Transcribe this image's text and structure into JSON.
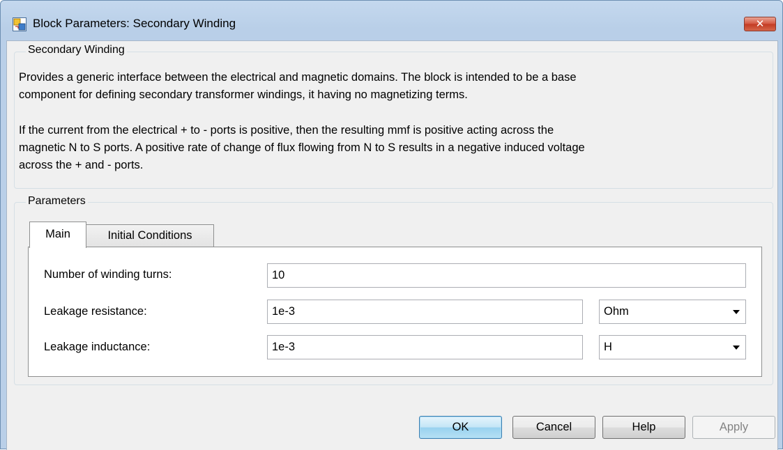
{
  "window": {
    "title": "Block Parameters: Secondary Winding",
    "close_glyph": "✕",
    "icon": "simulink-block-icon"
  },
  "description_group": {
    "title": "Secondary Winding",
    "paragraph1": "Provides a generic interface between the electrical and magnetic domains. The block is intended to be a base\ncomponent for defining secondary transformer windings, it having no magnetizing terms.",
    "paragraph2": "If the current from the electrical + to - ports is positive, then the resulting mmf is positive acting across the\nmagnetic N to S ports. A positive rate of change of flux flowing from N to S results in a negative induced voltage\nacross the + and - ports."
  },
  "parameters_group": {
    "title": "Parameters",
    "tabs": [
      {
        "label": "Main",
        "selected": true
      },
      {
        "label": "Initial Conditions",
        "selected": false
      }
    ],
    "fields": [
      {
        "label": "Number of winding turns:",
        "value": "10"
      },
      {
        "label": "Leakage resistance:",
        "value": "1e-3",
        "unit": "Ohm"
      },
      {
        "label": "Leakage inductance:",
        "value": "1e-3",
        "unit": "H"
      }
    ]
  },
  "buttons": {
    "ok": "OK",
    "cancel": "Cancel",
    "help": "Help",
    "apply": "Apply"
  },
  "colors": {
    "title_bar": "#b9cfe8",
    "close_button": "#c9462c",
    "dialog_bg": "#f0f0f0",
    "ok_button": "#b6e0f4"
  }
}
